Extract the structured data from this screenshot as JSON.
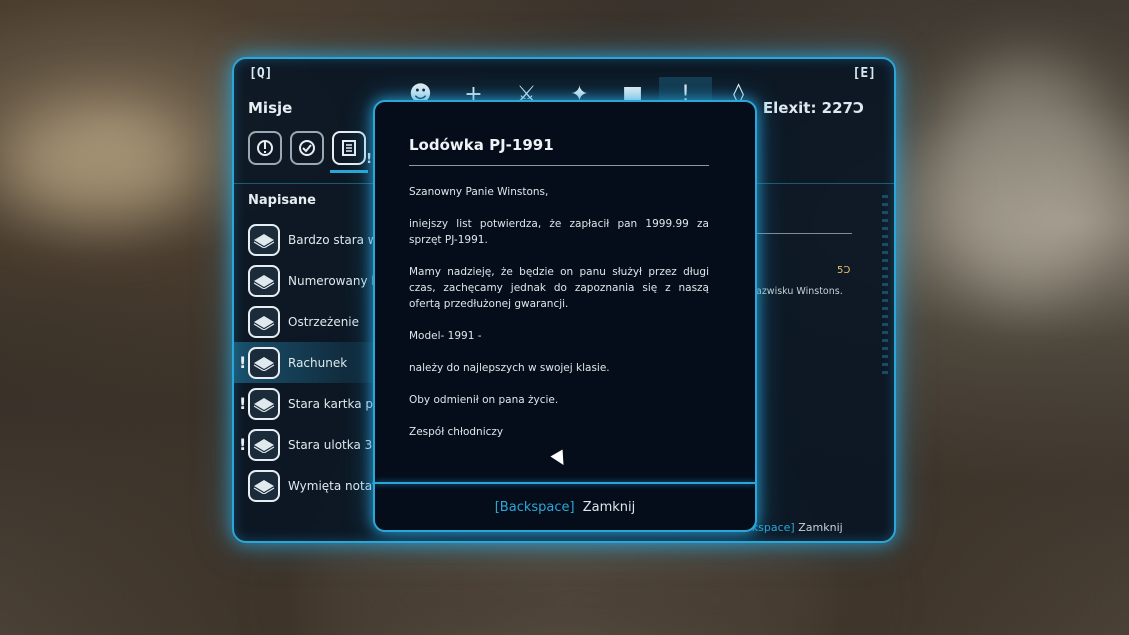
{
  "hud": {
    "key_left": "[Q]",
    "key_right": "[E]",
    "currency": "Elexit: 227Ɔ"
  },
  "top_tabs": [
    {
      "icon": "character-icon",
      "glyph": "☻"
    },
    {
      "icon": "plus-icon",
      "glyph": "+"
    },
    {
      "icon": "crossed-swords-icon",
      "glyph": "⚔"
    },
    {
      "icon": "armor-icon",
      "glyph": "✦"
    },
    {
      "icon": "box-icon",
      "glyph": "■"
    },
    {
      "icon": "quest-exclamation-icon",
      "glyph": "!"
    },
    {
      "icon": "map-marker-icon",
      "glyph": "◊"
    }
  ],
  "missions": {
    "title": "Misje",
    "categories": [
      "active-quests-icon",
      "completed-quests-icon",
      "documents-icon"
    ],
    "section_title": "Napisane",
    "items": [
      {
        "label": "Bardzo stara wia",
        "new": false,
        "selected": false
      },
      {
        "label": "Numerowany kaw",
        "new": false,
        "selected": false
      },
      {
        "label": "Ostrzeżenie",
        "new": false,
        "selected": false
      },
      {
        "label": "Rachunek",
        "new": true,
        "selected": true
      },
      {
        "label": "Stara kartka pap",
        "new": true,
        "selected": false
      },
      {
        "label": "Stara ulotka 3",
        "new": true,
        "selected": false
      },
      {
        "label": "Wymięta notatka",
        "new": false,
        "selected": false
      }
    ]
  },
  "background_panel": {
    "reward": "5Ɔ",
    "text": "azwisku Winstons.",
    "footer_key": "ackspace]",
    "footer_action": "Zamknij"
  },
  "modal": {
    "title": "Lodówka PJ-1991",
    "paragraphs": [
      "Szanowny Panie Winstons,",
      "iniejszy list potwierdza, że zapłacił pan 1999.99 za sprzęt PJ-1991.",
      "Mamy nadzieję, że będzie on panu służył przez długi czas, zachęcamy jednak do zapoznania się z naszą ofertą przedłużonej gwarancji.",
      " Model- 1991 -",
      "należy do najlepszych w swojej klasie.",
      "Oby odmienił on pana życie.",
      "Zespół chłodniczy"
    ],
    "footer_key": "[Backspace]",
    "footer_action": "Zamknij"
  }
}
